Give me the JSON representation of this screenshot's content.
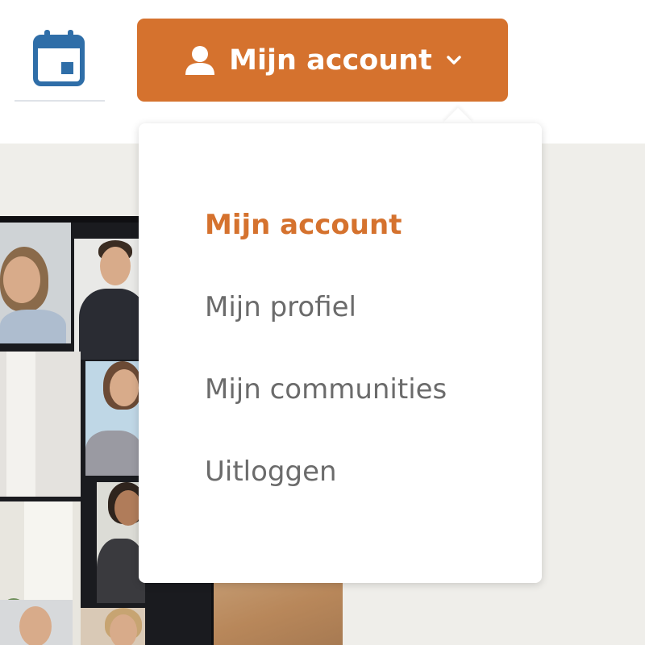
{
  "header": {
    "account_button_label": "Mijn account",
    "icons": {
      "calendar": "calendar-icon",
      "user": "user-icon",
      "chevron": "chevron-down-icon"
    }
  },
  "dropdown": {
    "items": [
      {
        "label": "Mijn account",
        "active": true
      },
      {
        "label": "Mijn profiel",
        "active": false
      },
      {
        "label": "Mijn communities",
        "active": false
      },
      {
        "label": "Uitloggen",
        "active": false
      }
    ]
  },
  "colors": {
    "accent": "#d5722e",
    "calendar_icon": "#2f6ea8",
    "menu_text": "#6b6b6b",
    "content_background": "#efeeea"
  }
}
